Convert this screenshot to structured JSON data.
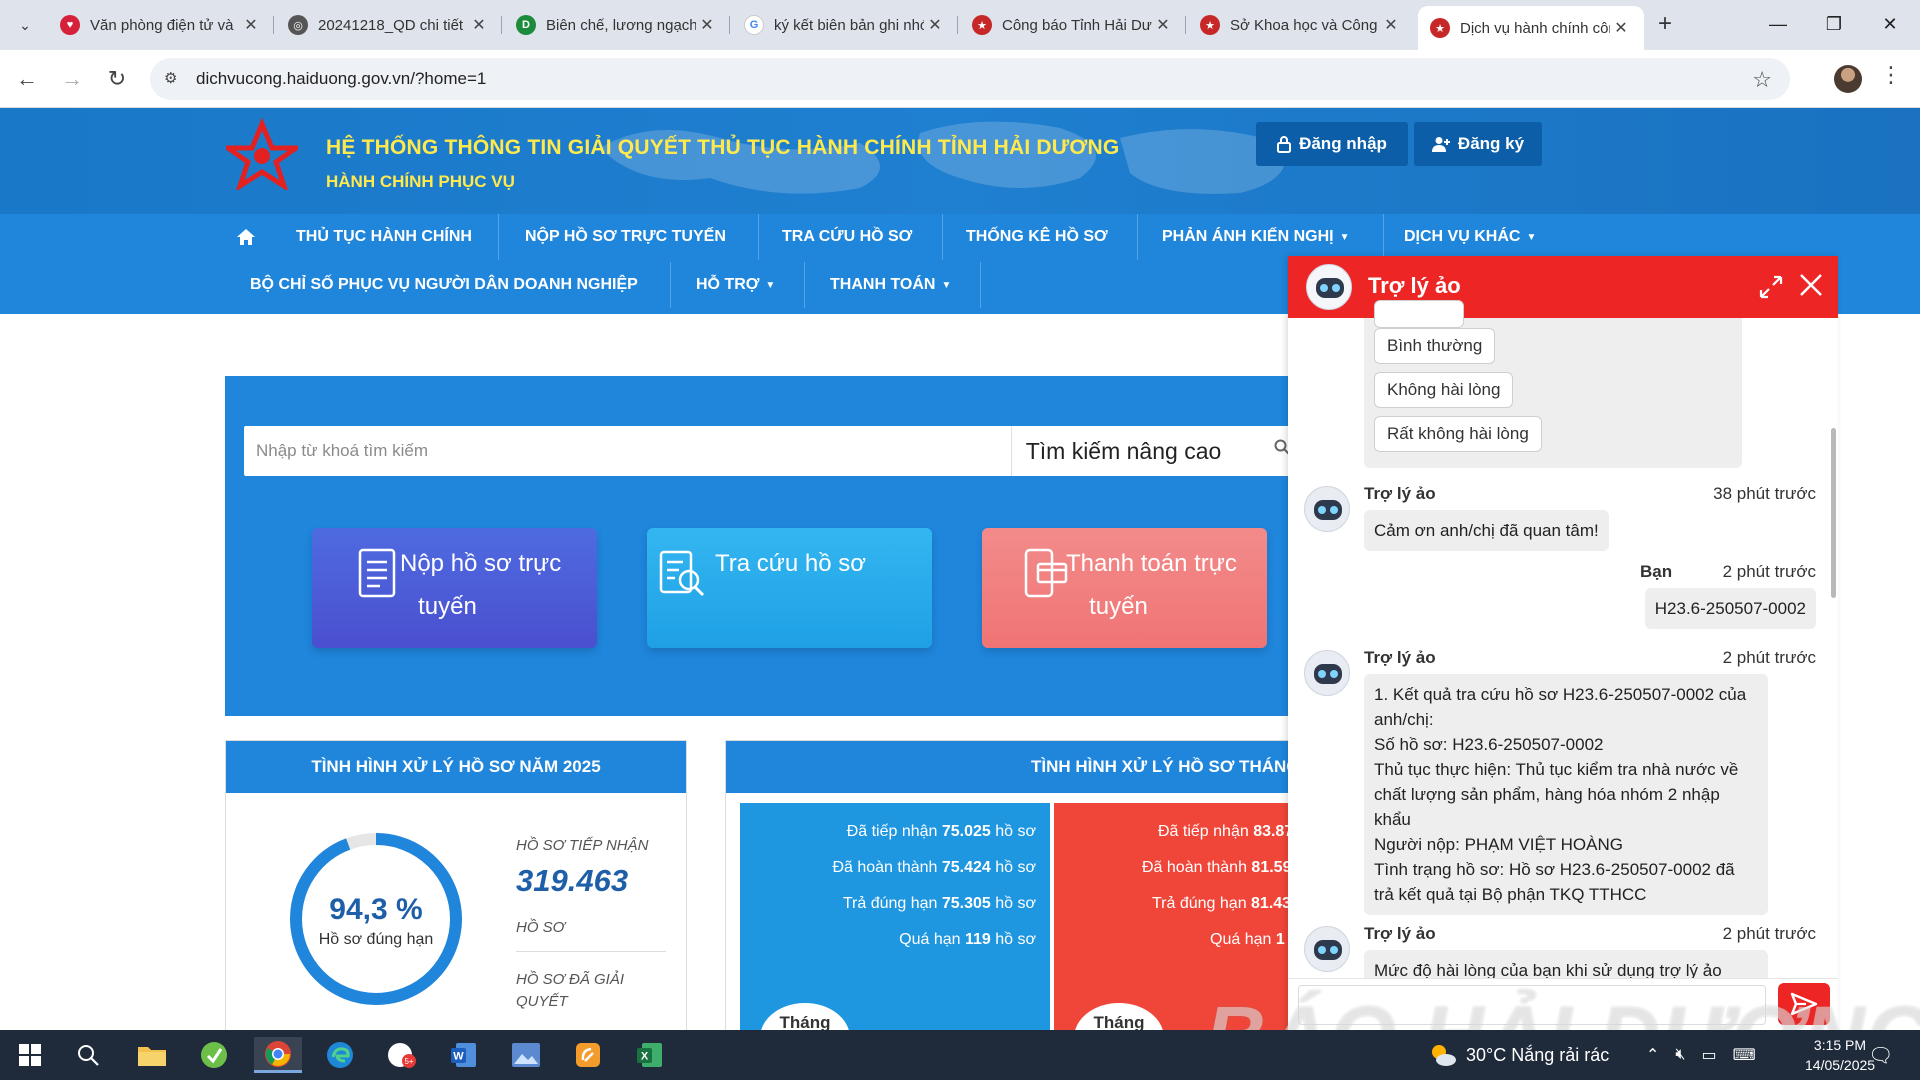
{
  "browser": {
    "tabs": [
      {
        "title": "Văn phòng điện tử và",
        "favicon": "heart-red-icon",
        "color": "#d6213b"
      },
      {
        "title": "20241218_QD chi tiết",
        "favicon": "globe-icon",
        "color": "#555555"
      },
      {
        "title": "Biên chế, lương ngạch",
        "favicon": "d-green-icon",
        "color": "#1c8c3c"
      },
      {
        "title": "ký kết biên bản ghi nhớ",
        "favicon": "google-icon",
        "color": "#4285f4"
      },
      {
        "title": "Công báo Tỉnh Hải Dương",
        "favicon": "emblem-icon",
        "color": "#c62828"
      },
      {
        "title": "Sở Khoa học và Công",
        "favicon": "emblem-icon",
        "color": "#c62828"
      },
      {
        "title": "Dịch vụ hành chính công",
        "favicon": "emblem-icon",
        "color": "#c62828"
      }
    ],
    "close_glyph": "✕",
    "new_tab_glyph": "+",
    "url": "dichvucong.haiduong.gov.vn/?home=1"
  },
  "site": {
    "title": "HỆ THỐNG THÔNG TIN GIẢI QUYẾT THỦ TỤC HÀNH CHÍNH TỈNH HẢI DƯƠNG",
    "subtitle": "HÀNH CHÍNH PHỤC VỤ",
    "login_label": "Đăng nhập",
    "register_label": "Đăng ký",
    "brand_color": "#1f86dc",
    "title_color": "#ffe94d"
  },
  "nav": {
    "row1": [
      "THỦ TỤC HÀNH CHÍNH",
      "NỘP HỒ SƠ TRỰC TUYẾN",
      "TRA CỨU HỒ SƠ",
      "THỐNG KÊ HỒ SƠ",
      "PHẢN ÁNH KIẾN NGHỊ",
      "DỊCH VỤ KHÁC"
    ],
    "row2": [
      "BỘ CHỈ SỐ PHỤC VỤ NGƯỜI DÂN DOANH NGHIỆP",
      "HỖ TRỢ",
      "THANH TOÁN"
    ]
  },
  "search": {
    "placeholder": "Nhập từ khoá tìm kiếm",
    "advanced_label": "Tìm kiếm nâng cao"
  },
  "cards": [
    {
      "label_line1": "Nộp hồ sơ trực",
      "label_line2": "tuyến",
      "color": "#4a58d6"
    },
    {
      "label_line1": "Tra cứu hồ sơ",
      "label_line2": "",
      "color": "#22a8ea"
    },
    {
      "label_line1": "Thanh toán trực",
      "label_line2": "tuyến",
      "color": "#f27d7d"
    }
  ],
  "stats_year": {
    "heading": "TÌNH HÌNH XỬ LÝ HỒ SƠ NĂM 2025",
    "percent_label": "94,3 %",
    "percent_value": 94.3,
    "percent_caption": "Hồ sơ đúng hạn",
    "received_label": "HỒ SƠ TIẾP NHẬN",
    "received_value": "319.463",
    "received_unit": "HỒ SƠ",
    "resolved_label_line1": "HỒ SƠ ĐÃ GIẢI",
    "resolved_label_line2": "QUYẾT"
  },
  "stats_month": {
    "heading": "TÌNH HÌNH XỬ LÝ HỒ SƠ THÁNG",
    "boxes": [
      {
        "color": "#1f97e0",
        "rows": [
          {
            "prefix": "Đã tiếp nhận ",
            "value": "75.025",
            "suffix": " hồ sơ"
          },
          {
            "prefix": "Đã hoàn thành ",
            "value": "75.424",
            "suffix": " hồ sơ"
          },
          {
            "prefix": "Trả đúng hạn ",
            "value": "75.305",
            "suffix": " hồ sơ"
          },
          {
            "prefix": "Quá hạn ",
            "value": "119",
            "suffix": " hồ sơ"
          }
        ],
        "badge": "Tháng"
      },
      {
        "color": "#f0463a",
        "rows": [
          {
            "prefix": "Đã tiếp nhận ",
            "value": "83.87",
            "suffix": ""
          },
          {
            "prefix": "Đã hoàn thành ",
            "value": "81.59",
            "suffix": ""
          },
          {
            "prefix": "Trả đúng hạn ",
            "value": "81.43",
            "suffix": ""
          },
          {
            "prefix": "Quá hạn ",
            "value": "1",
            "suffix": ""
          }
        ],
        "badge": "Tháng"
      }
    ]
  },
  "watermark": "BÁO HẢI DƯƠNG",
  "chat": {
    "title": "Trợ lý ảo",
    "options": [
      "Bình thường",
      "Không hài lòng",
      "Rất không hài lòng"
    ],
    "messages": [
      {
        "sender": "Trợ lý ảo",
        "time": "38 phút trước",
        "lines": [
          "Cảm ơn anh/chị đã quan tâm!"
        ]
      },
      {
        "sender": "Bạn",
        "time": "2 phút trước",
        "lines": [
          "H23.6-250507-0002"
        ]
      },
      {
        "sender": "Trợ lý ảo",
        "time": "2 phút trước",
        "lines": [
          "1. Kết quả tra cứu hồ sơ H23.6-250507-0002 của",
          "anh/chị:",
          "Số hồ sơ: H23.6-250507-0002",
          "Thủ tục thực hiện: Thủ tục kiểm tra nhà nước về",
          "chất lượng sản phẩm, hàng hóa nhóm 2 nhập",
          "khẩu",
          "Người nộp: PHẠM VIỆT HOÀNG",
          "Tình trạng hồ sơ: Hồ sơ H23.6-250507-0002 đã",
          "trả kết quả tại Bộ phận TKQ TTHCC"
        ]
      },
      {
        "sender": "Trợ lý ảo",
        "time": "2 phút trước",
        "lines": [
          "Mức độ hài lòng của bạn khi sử dụng trợ lý ảo"
        ]
      }
    ],
    "input_placeholder": "",
    "header_color": "#ee2525"
  },
  "taskbar": {
    "weather": "30°C  Nắng rải rác",
    "time": "3:15 PM",
    "date": "14/05/2025"
  }
}
